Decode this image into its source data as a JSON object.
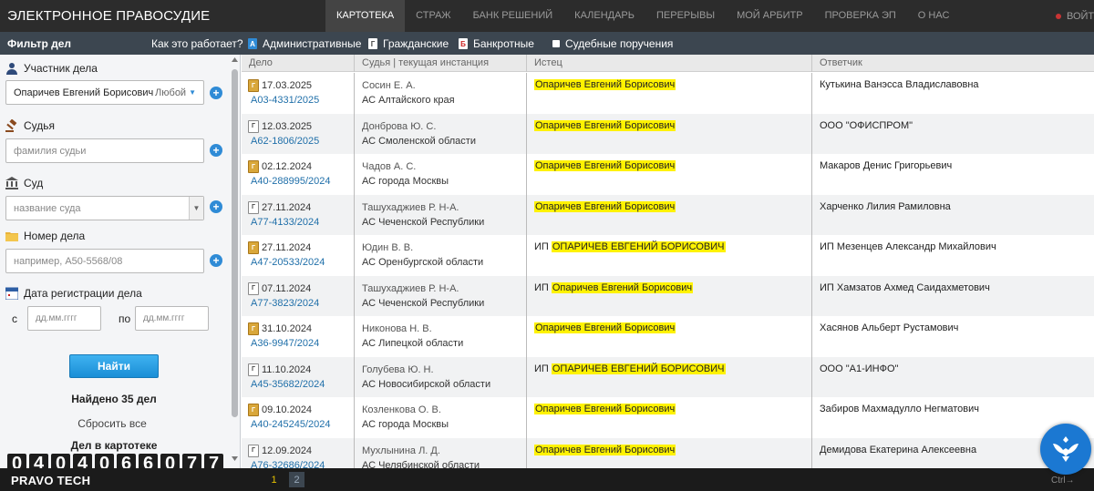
{
  "header": {
    "title": "ЭЛЕКТРОННОЕ ПРАВОСУДИЕ",
    "nav": [
      "КАРТОТЕКА",
      "СТРАЖ",
      "БАНК РЕШЕНИЙ",
      "КАЛЕНДАРЬ",
      "ПЕРЕРЫВЫ",
      "МОЙ АРБИТР",
      "ПРОВЕРКА ЭП",
      "О НАС"
    ],
    "active_nav": "КАРТОТЕКА",
    "login_label": "ВОЙТИ"
  },
  "filterbar": {
    "title": "Фильтр дел",
    "howto": "Как это работает?",
    "types": [
      {
        "mark": "А",
        "label": "Административные"
      },
      {
        "mark": "Г",
        "label": "Гражданские"
      },
      {
        "mark": "Б",
        "label": "Банкротные"
      },
      {
        "mark": "",
        "label": "Судебные поручения"
      }
    ]
  },
  "sidebar": {
    "participant_label": "Участник дела",
    "participant_value": "Опаричев Евгений Борисович",
    "participant_role": "Любой",
    "judge_label": "Судья",
    "judge_placeholder": "фамилия судьи",
    "court_label": "Суд",
    "court_placeholder": "название суда",
    "case_number_label": "Номер дела",
    "case_number_placeholder": "например, А50-5568/08",
    "reg_date_label": "Дата регистрации дела",
    "date_from_label": "с",
    "date_to_label": "по",
    "date_placeholder": "дд.мм.гггг",
    "search_button": "Найти",
    "found_text": "Найдено 35 дел",
    "reset_text": "Сбросить все",
    "cards_title": "Дел в картотеке",
    "counter_digits": [
      "0",
      "4",
      "0",
      "4",
      "0",
      "6",
      "6",
      "0",
      "7",
      "7"
    ]
  },
  "table": {
    "columns": [
      "Дело",
      "Судья | текущая инстанция",
      "Истец",
      "Ответчик"
    ],
    "rows": [
      {
        "type": "bank",
        "date": "17.03.2025",
        "number": "А03-4331/2025",
        "judge": "Сосин Е. А.",
        "court": "АС Алтайского края",
        "prefix": "",
        "plaintiff": "Опаричев Евгений Борисович",
        "defendant": "Кутькина Ванэсса Владиславовна"
      },
      {
        "type": "civil",
        "date": "12.03.2025",
        "number": "А62-1806/2025",
        "judge": "Донброва Ю. С.",
        "court": "АС Смоленской области",
        "prefix": "",
        "plaintiff": "Опаричев Евгений Борисович",
        "defendant": "ООО \"ОФИСПРОМ\""
      },
      {
        "type": "bank",
        "date": "02.12.2024",
        "number": "А40-288995/2024",
        "judge": "Чадов А. С.",
        "court": "АС города Москвы",
        "prefix": "",
        "plaintiff": "Опаричев Евгений Борисович",
        "defendant": "Макаров Денис Григорьевич"
      },
      {
        "type": "civil",
        "date": "27.11.2024",
        "number": "А77-4133/2024",
        "judge": "Ташухаджиев Р. Н-А.",
        "court": "АС Чеченской Республики",
        "prefix": "",
        "plaintiff": "Опаричев Евгений Борисович",
        "defendant": "Харченко Лилия Рамиловна"
      },
      {
        "type": "bank",
        "date": "27.11.2024",
        "number": "А47-20533/2024",
        "judge": "Юдин В. В.",
        "court": "АС Оренбургской области",
        "prefix": "ИП",
        "plaintiff": "ОПАРИЧЕВ ЕВГЕНИЙ БОРИСОВИЧ",
        "defendant": "ИП Мезенцев Александр Михайлович"
      },
      {
        "type": "civil",
        "date": "07.11.2024",
        "number": "А77-3823/2024",
        "judge": "Ташухаджиев Р. Н-А.",
        "court": "АС Чеченской Республики",
        "prefix": "ИП",
        "plaintiff": "Опаричев Евгений Борисович",
        "defendant": "ИП Хамзатов Ахмед Саидахметович"
      },
      {
        "type": "bank",
        "date": "31.10.2024",
        "number": "А36-9947/2024",
        "judge": "Никонова Н. В.",
        "court": "АС Липецкой области",
        "prefix": "",
        "plaintiff": "Опаричев Евгений Борисович",
        "defendant": "Хасянов Альберт Рустамович"
      },
      {
        "type": "civil",
        "date": "11.10.2024",
        "number": "А45-35682/2024",
        "judge": "Голубева Ю. Н.",
        "court": "АС Новосибирской области",
        "prefix": "ИП",
        "plaintiff": "ОПАРИЧЕВ ЕВГЕНИЙ БОРИСОВИЧ",
        "defendant": "ООО \"А1-ИНФО\""
      },
      {
        "type": "bank",
        "date": "09.10.2024",
        "number": "А40-245245/2024",
        "judge": "Козленкова О. В.",
        "court": "АС города Москвы",
        "prefix": "",
        "plaintiff": "Опаричев Евгений Борисович",
        "defendant": "Забиров Махмадулло Негматович"
      },
      {
        "type": "civil",
        "date": "12.09.2024",
        "number": "А76-32686/2024",
        "judge": "Мухлынина Л. Д.",
        "court": "АС Челябинской области",
        "prefix": "",
        "plaintiff": "Опаричев Евгений Борисович",
        "defendant": "Демидова Екатерина Алексеевна"
      }
    ]
  },
  "footer": {
    "brand": "PRAVO TECH",
    "pages": [
      "1",
      "2"
    ],
    "current_page": "1",
    "shortcut": "Ctrl→"
  },
  "colors": {
    "topbar": "#2c2c2c",
    "filterbar": "#3c4650",
    "highlight": "#fff200",
    "link": "#1f6fa9",
    "accent": "#2f8bd6"
  }
}
